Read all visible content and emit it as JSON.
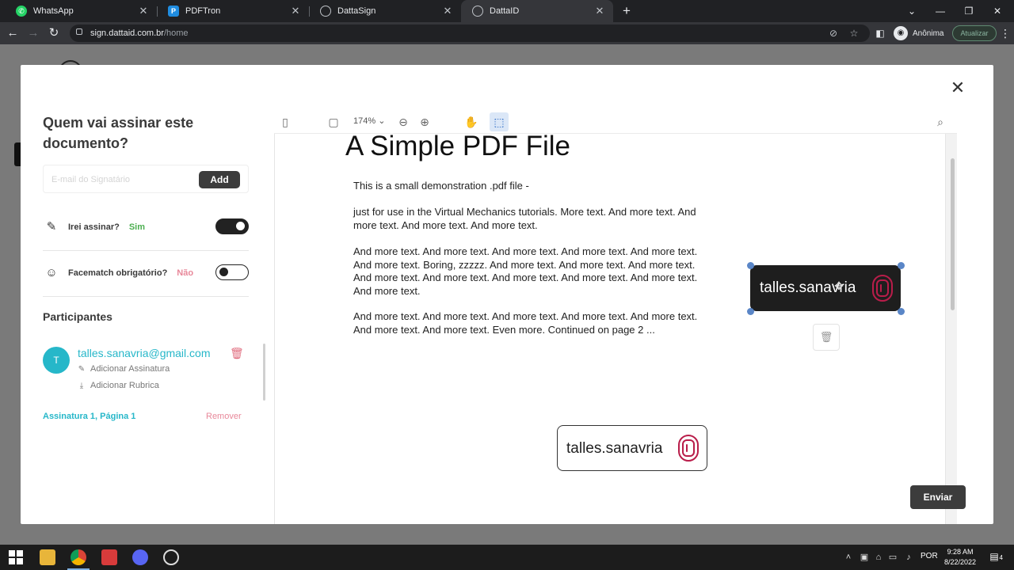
{
  "browser": {
    "tabs": [
      {
        "label": "WhatsApp",
        "icon": "whatsapp-icon",
        "color": "#25d366",
        "active": false
      },
      {
        "label": "PDFTron",
        "icon": "pdftron-icon",
        "color": "#1f8ce0",
        "active": false
      },
      {
        "label": "DattaSign",
        "icon": "globe-icon",
        "color": "#bdc1c6",
        "active": false
      },
      {
        "label": "DattaID",
        "icon": "globe-icon",
        "color": "#bdc1c6",
        "active": true
      }
    ],
    "url_host": "sign.dattaid.com.br",
    "url_path": "/home",
    "profile_label": "Anônima",
    "update_label": "Atualizar"
  },
  "signers_panel": {
    "title": "Quem vai assinar este documento?",
    "email_placeholder": "E-mail do Signatário",
    "add_label": "Add",
    "will_sign_label": "Irei assinar?",
    "will_sign_value": "Sim",
    "will_sign_color": "#4caf50",
    "facematch_label": "Facematch obrigatório?",
    "facematch_value": "Não",
    "facematch_color": "#e8889a",
    "participants_heading": "Participantes",
    "participant": {
      "initial": "T",
      "email": "talles.sanavria@gmail.com",
      "add_signature": "Adicionar Assinatura",
      "add_initials": "Adicionar Rubrica",
      "signature_info": "Assinatura 1, Página 1",
      "remove_label": "Remover"
    }
  },
  "viewer": {
    "zoom": "174%",
    "doc_title": "A Simple PDF File",
    "paragraphs": [
      "This is a small demonstration .pdf file -",
      "just for use in the Virtual Mechanics tutorials. More text. And more text. And more text. And more text. And more text.",
      "And more text. And more text. And more text. And more text. And more text. And more text. Boring, zzzzz. And more text. And more text. And more text. And more text. And more text. And more text. And more text. And more text. And more text.",
      "And more text. And more text. And more text. And more text. And more text. And more text. And more text. Even more. Continued on page 2 ..."
    ],
    "signature_selected": "talles.sanavria",
    "signature_placed": "talles.sanavria",
    "send_label": "Enviar"
  },
  "taskbar": {
    "language": "POR",
    "time": "9:28 AM",
    "date": "8/22/2022",
    "notifications": "4"
  }
}
